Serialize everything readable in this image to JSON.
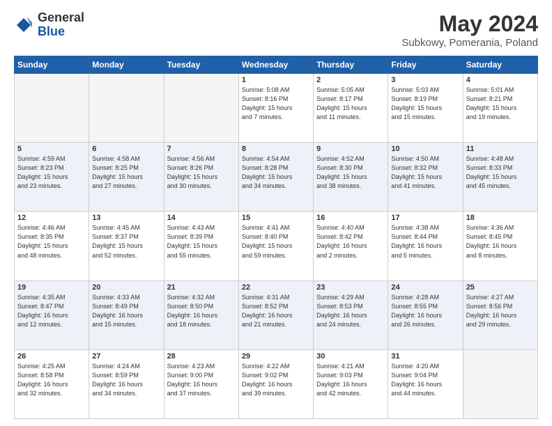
{
  "header": {
    "logo_general": "General",
    "logo_blue": "Blue",
    "title": "May 2024",
    "subtitle": "Subkowy, Pomerania, Poland"
  },
  "weekdays": [
    "Sunday",
    "Monday",
    "Tuesday",
    "Wednesday",
    "Thursday",
    "Friday",
    "Saturday"
  ],
  "weeks": [
    [
      {
        "day": "",
        "info": ""
      },
      {
        "day": "",
        "info": ""
      },
      {
        "day": "",
        "info": ""
      },
      {
        "day": "1",
        "info": "Sunrise: 5:08 AM\nSunset: 8:16 PM\nDaylight: 15 hours\nand 7 minutes."
      },
      {
        "day": "2",
        "info": "Sunrise: 5:05 AM\nSunset: 8:17 PM\nDaylight: 15 hours\nand 11 minutes."
      },
      {
        "day": "3",
        "info": "Sunrise: 5:03 AM\nSunset: 8:19 PM\nDaylight: 15 hours\nand 15 minutes."
      },
      {
        "day": "4",
        "info": "Sunrise: 5:01 AM\nSunset: 8:21 PM\nDaylight: 15 hours\nand 19 minutes."
      }
    ],
    [
      {
        "day": "5",
        "info": "Sunrise: 4:59 AM\nSunset: 8:23 PM\nDaylight: 15 hours\nand 23 minutes."
      },
      {
        "day": "6",
        "info": "Sunrise: 4:58 AM\nSunset: 8:25 PM\nDaylight: 15 hours\nand 27 minutes."
      },
      {
        "day": "7",
        "info": "Sunrise: 4:56 AM\nSunset: 8:26 PM\nDaylight: 15 hours\nand 30 minutes."
      },
      {
        "day": "8",
        "info": "Sunrise: 4:54 AM\nSunset: 8:28 PM\nDaylight: 15 hours\nand 34 minutes."
      },
      {
        "day": "9",
        "info": "Sunrise: 4:52 AM\nSunset: 8:30 PM\nDaylight: 15 hours\nand 38 minutes."
      },
      {
        "day": "10",
        "info": "Sunrise: 4:50 AM\nSunset: 8:32 PM\nDaylight: 15 hours\nand 41 minutes."
      },
      {
        "day": "11",
        "info": "Sunrise: 4:48 AM\nSunset: 8:33 PM\nDaylight: 15 hours\nand 45 minutes."
      }
    ],
    [
      {
        "day": "12",
        "info": "Sunrise: 4:46 AM\nSunset: 8:35 PM\nDaylight: 15 hours\nand 48 minutes."
      },
      {
        "day": "13",
        "info": "Sunrise: 4:45 AM\nSunset: 8:37 PM\nDaylight: 15 hours\nand 52 minutes."
      },
      {
        "day": "14",
        "info": "Sunrise: 4:43 AM\nSunset: 8:39 PM\nDaylight: 15 hours\nand 55 minutes."
      },
      {
        "day": "15",
        "info": "Sunrise: 4:41 AM\nSunset: 8:40 PM\nDaylight: 15 hours\nand 59 minutes."
      },
      {
        "day": "16",
        "info": "Sunrise: 4:40 AM\nSunset: 8:42 PM\nDaylight: 16 hours\nand 2 minutes."
      },
      {
        "day": "17",
        "info": "Sunrise: 4:38 AM\nSunset: 8:44 PM\nDaylight: 16 hours\nand 5 minutes."
      },
      {
        "day": "18",
        "info": "Sunrise: 4:36 AM\nSunset: 8:45 PM\nDaylight: 16 hours\nand 8 minutes."
      }
    ],
    [
      {
        "day": "19",
        "info": "Sunrise: 4:35 AM\nSunset: 8:47 PM\nDaylight: 16 hours\nand 12 minutes."
      },
      {
        "day": "20",
        "info": "Sunrise: 4:33 AM\nSunset: 8:49 PM\nDaylight: 16 hours\nand 15 minutes."
      },
      {
        "day": "21",
        "info": "Sunrise: 4:32 AM\nSunset: 8:50 PM\nDaylight: 16 hours\nand 18 minutes."
      },
      {
        "day": "22",
        "info": "Sunrise: 4:31 AM\nSunset: 8:52 PM\nDaylight: 16 hours\nand 21 minutes."
      },
      {
        "day": "23",
        "info": "Sunrise: 4:29 AM\nSunset: 8:53 PM\nDaylight: 16 hours\nand 24 minutes."
      },
      {
        "day": "24",
        "info": "Sunrise: 4:28 AM\nSunset: 8:55 PM\nDaylight: 16 hours\nand 26 minutes."
      },
      {
        "day": "25",
        "info": "Sunrise: 4:27 AM\nSunset: 8:56 PM\nDaylight: 16 hours\nand 29 minutes."
      }
    ],
    [
      {
        "day": "26",
        "info": "Sunrise: 4:25 AM\nSunset: 8:58 PM\nDaylight: 16 hours\nand 32 minutes."
      },
      {
        "day": "27",
        "info": "Sunrise: 4:24 AM\nSunset: 8:59 PM\nDaylight: 16 hours\nand 34 minutes."
      },
      {
        "day": "28",
        "info": "Sunrise: 4:23 AM\nSunset: 9:00 PM\nDaylight: 16 hours\nand 37 minutes."
      },
      {
        "day": "29",
        "info": "Sunrise: 4:22 AM\nSunset: 9:02 PM\nDaylight: 16 hours\nand 39 minutes."
      },
      {
        "day": "30",
        "info": "Sunrise: 4:21 AM\nSunset: 9:03 PM\nDaylight: 16 hours\nand 42 minutes."
      },
      {
        "day": "31",
        "info": "Sunrise: 4:20 AM\nSunset: 9:04 PM\nDaylight: 16 hours\nand 44 minutes."
      },
      {
        "day": "",
        "info": ""
      }
    ]
  ]
}
